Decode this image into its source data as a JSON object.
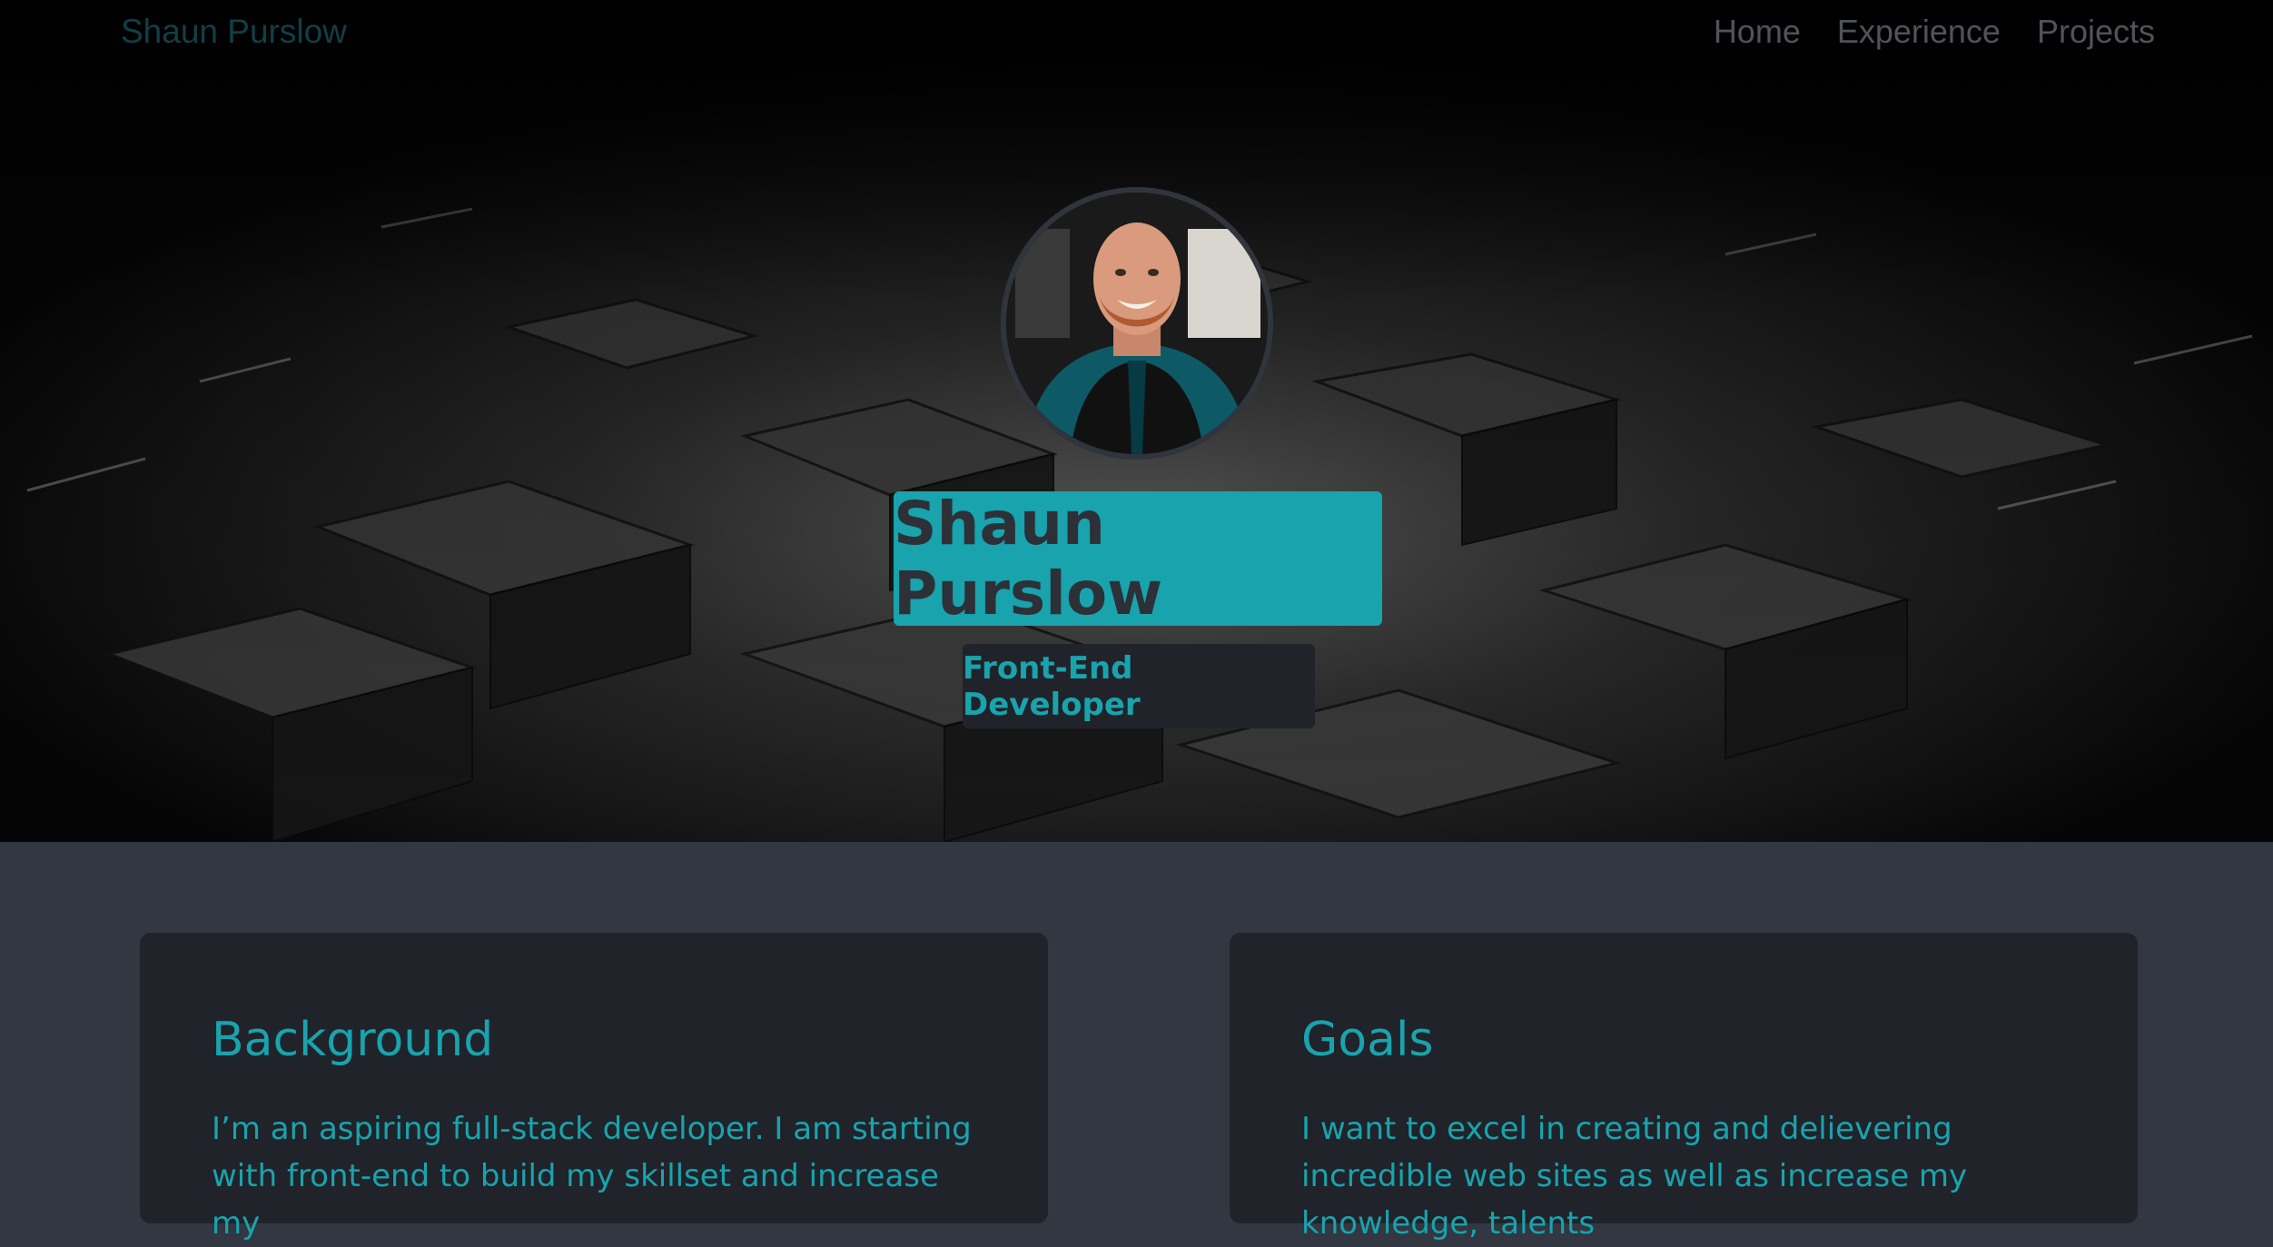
{
  "navbar": {
    "brand": "Shaun Purslow",
    "links": [
      "Home",
      "Experience",
      "Projects"
    ]
  },
  "hero": {
    "name": "Shaun Purslow",
    "role": "Front-End Developer"
  },
  "cards": {
    "background": {
      "title": "Background",
      "body": "I’m an aspiring full-stack developer. I am starting with front-end to build my skillset and increase my"
    },
    "goals": {
      "title": "Goals",
      "body": "I want to excel in creating and delievering incredible web sites as well as increase my knowledge, talents"
    }
  },
  "colors": {
    "accent": "#18a3ad",
    "card_bg": "#20232a",
    "page_bg": "#323741",
    "hero_bg": "#050505"
  }
}
